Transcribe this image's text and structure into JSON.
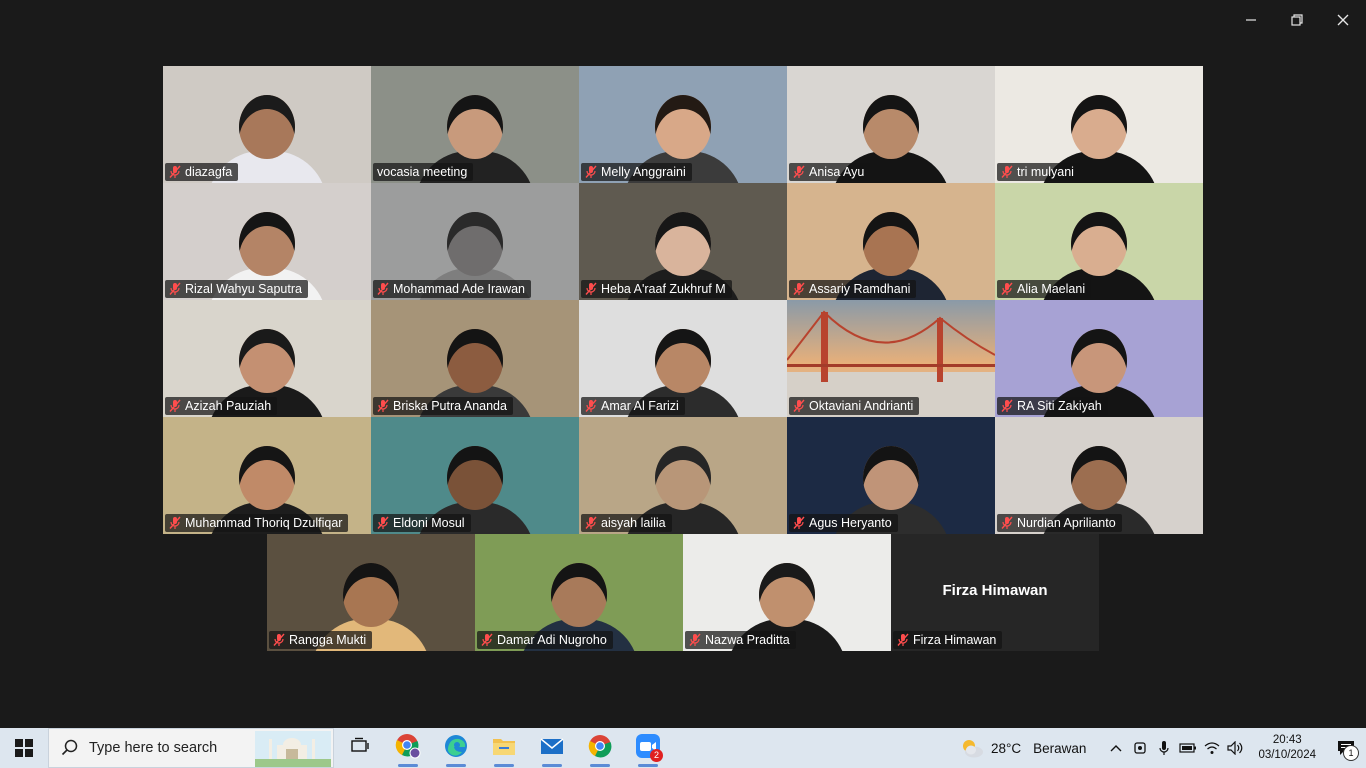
{
  "window": {
    "minimize_icon": "minimize-icon",
    "maximize_icon": "restore-icon",
    "close_icon": "close-icon"
  },
  "participants": [
    {
      "name": "diazagfa",
      "muted": true,
      "bg": "#cfcac4",
      "skin": "#a8785a",
      "hair": "#1b1b1b",
      "cloth": "#e8e8ee"
    },
    {
      "name": "vocasia meeting",
      "muted": false,
      "active": true,
      "bg": "#8c9088",
      "skin": "#c89a7c",
      "hair": "#151515",
      "cloth": "#222"
    },
    {
      "name": "Melly Anggraini",
      "muted": true,
      "bg": "#8fa1b4",
      "skin": "#d8a888",
      "hair": "#231a14",
      "cloth": "#3b3b3b"
    },
    {
      "name": "Anisa Ayu",
      "muted": true,
      "bg": "#d9d6d2",
      "skin": "#b88a6a",
      "hair": "#141414",
      "cloth": "#141414"
    },
    {
      "name": "tri mulyani",
      "muted": true,
      "bg": "#ece9e3",
      "skin": "#d9ac8e",
      "hair": "#141414",
      "cloth": "#141414"
    },
    {
      "name": "Rizal Wahyu Saputra",
      "muted": true,
      "bg": "#d4cfcc",
      "skin": "#b48466",
      "hair": "#151515",
      "cloth": "#f2f2f2"
    },
    {
      "name": "Mohammad Ade Irawan",
      "muted": true,
      "bg": "#9c9d9d",
      "skin": "#6f6d6d",
      "hair": "#2a2a2a",
      "cloth": "#7e7e7e"
    },
    {
      "name": "Heba A'raaf Zukhruf M",
      "muted": true,
      "bg": "#5f5a50",
      "skin": "#d9b49c",
      "hair": "#171717",
      "cloth": "#1d1d1d"
    },
    {
      "name": "Assariy Ramdhani",
      "muted": true,
      "bg": "#d6b48e",
      "skin": "#a87452",
      "hair": "#141414",
      "cloth": "#1e2533"
    },
    {
      "name": "Alia Maelani",
      "muted": true,
      "bg": "#c9d6a8",
      "skin": "#d9ae90",
      "hair": "#141414",
      "cloth": "#141414"
    },
    {
      "name": "Azizah Pauziah",
      "muted": true,
      "bg": "#d9d5cc",
      "skin": "#c49072",
      "hair": "#1a1a1a",
      "cloth": "#1a1a1a"
    },
    {
      "name": "Briska Putra Ananda",
      "muted": true,
      "bg": "#a69478",
      "skin": "#8c5c40",
      "hair": "#141414",
      "cloth": "#3a3a3a"
    },
    {
      "name": "Amar Al Farizi",
      "muted": true,
      "bg": "#dedede",
      "skin": "#b88766",
      "hair": "#151515",
      "cloth": "#2c2c2c"
    },
    {
      "name": "Oktaviani Andrianti",
      "muted": true,
      "bg": "#b7a596",
      "skin": "#b7a596",
      "hair": "#b7a596",
      "cloth": "#b7a596",
      "nohuman": true
    },
    {
      "name": "RA Siti Zakiyah",
      "muted": true,
      "bg": "#a7a2d4",
      "skin": "#c8967a",
      "hair": "#141414",
      "cloth": "#141414"
    },
    {
      "name": "Muhammad Thoriq Dzulfiqar",
      "muted": true,
      "bg": "#c4b388",
      "skin": "#c08a68",
      "hair": "#151515",
      "cloth": "#1d1d1d"
    },
    {
      "name": "Eldoni Mosul",
      "muted": true,
      "bg": "#4f8a8a",
      "skin": "#7a5238",
      "hair": "#141414",
      "cloth": "#2a2a2a"
    },
    {
      "name": "aisyah lailia",
      "muted": true,
      "bg": "#b9a687",
      "skin": "#b89678",
      "hair": "#262626",
      "cloth": "#262626"
    },
    {
      "name": "Agus Heryanto",
      "muted": true,
      "bg": "#1c2a44",
      "skin": "#c09478",
      "hair": "#141414",
      "cloth": "#2d2d2d"
    },
    {
      "name": "Nurdian Aprilianto",
      "muted": true,
      "bg": "#d6d1cc",
      "skin": "#9c6e50",
      "hair": "#141414",
      "cloth": "#2a2a2a"
    },
    {
      "name": "Rangga Mukti",
      "muted": true,
      "bg": "#5b5040",
      "skin": "#a87652",
      "hair": "#141414",
      "cloth": "#e2b87a"
    },
    {
      "name": "Damar Adi Nugroho",
      "muted": true,
      "bg": "#7f9c56",
      "skin": "#a87a5a",
      "hair": "#141414",
      "cloth": "#233042"
    },
    {
      "name": "Nazwa Praditta",
      "muted": true,
      "bg": "#ececea",
      "skin": "#c0906e",
      "hair": "#1a1a1a",
      "cloth": "#1a1a1a"
    },
    {
      "name": "Firza Himawan",
      "muted": true,
      "noimg": true,
      "bg": "#262626"
    }
  ],
  "taskbar": {
    "search_placeholder": "Type here to search",
    "apps": [
      {
        "icon": "task-view-icon"
      },
      {
        "icon": "chrome-icon-profile"
      },
      {
        "icon": "edge-icon"
      },
      {
        "icon": "file-explorer-icon"
      },
      {
        "icon": "mail-icon"
      },
      {
        "icon": "chrome-icon"
      },
      {
        "icon": "zoom-icon",
        "badge": "2"
      }
    ],
    "weather": {
      "temp": "28°C",
      "desc": "Berawan"
    },
    "clock": {
      "time": "20:43",
      "date": "03/10/2024"
    },
    "notifications": "1"
  }
}
